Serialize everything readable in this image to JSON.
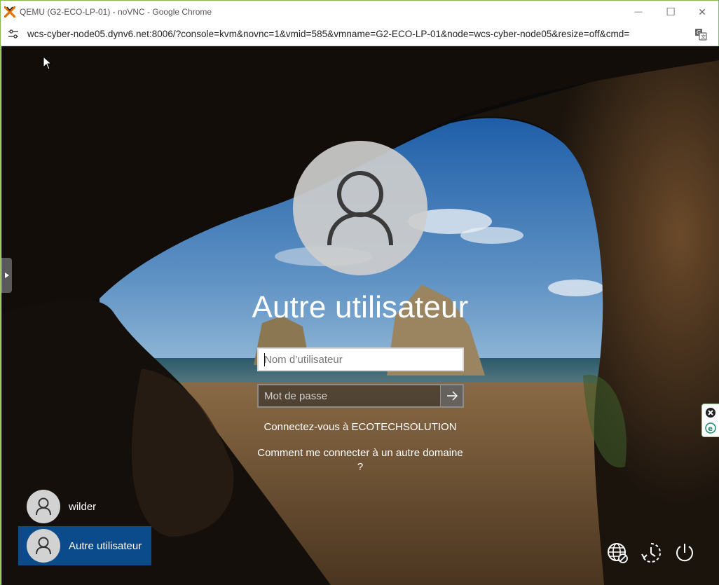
{
  "window": {
    "title": "QEMU (G2-ECO-LP-01) - noVNC - Google Chrome",
    "minimize_glyph": "—",
    "maximize_glyph": "☐",
    "close_glyph": "✕"
  },
  "address_bar": {
    "url": "wcs-cyber-node05.dynv6.net:8006/?console=kvm&novnc=1&vmid=585&vmname=G2-ECO-LP-01&node=wcs-cyber-node05&resize=off&cmd="
  },
  "login": {
    "user_title": "Autre utilisateur",
    "username_placeholder": "Nom d’utilisateur",
    "username_value": "",
    "password_placeholder": "Mot de passe",
    "password_value": "",
    "signin_to": "Connectez-vous à ECOTECHSOLUTION",
    "domain_help": "Comment me connecter à un autre domaine ?"
  },
  "users": [
    {
      "name": "wilder",
      "selected": false
    },
    {
      "name": "Autre utilisateur",
      "selected": true
    }
  ],
  "system_icons": [
    "network-icon",
    "accessibility-icon",
    "power-icon"
  ],
  "colors": {
    "selected_user_bg": "#0b4b8c",
    "window_border": "#7fbf4a",
    "proxmox_orange": "#e57000"
  }
}
